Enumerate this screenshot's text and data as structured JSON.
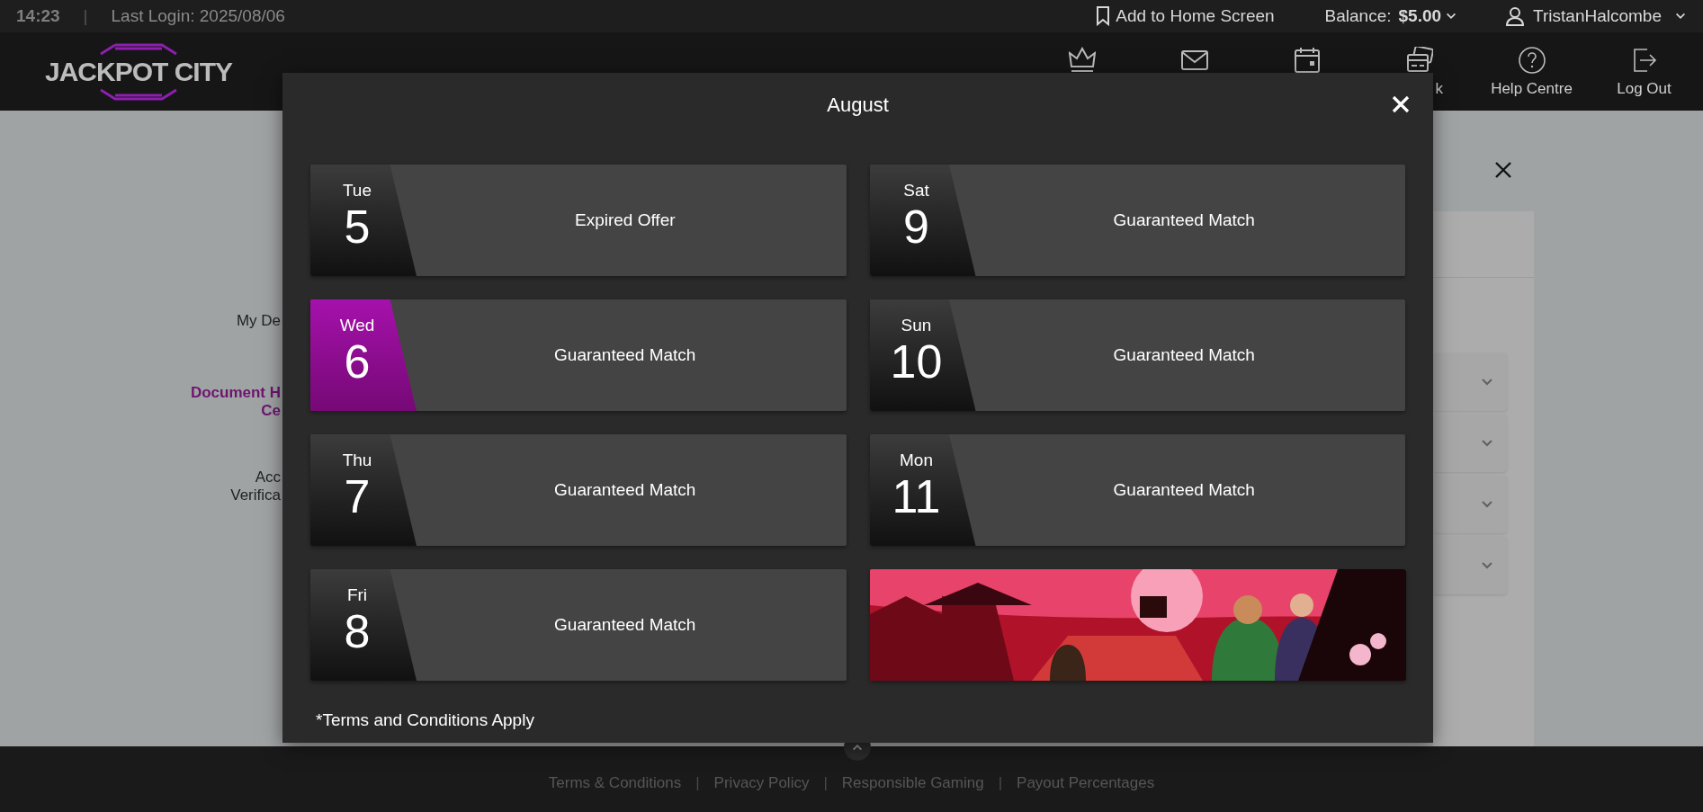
{
  "top_bar": {
    "time": "14:23",
    "separator": "|",
    "last_login": "Last Login: 2025/08/06",
    "add_to_home": "Add to Home Screen",
    "balance_label": "Balance:",
    "balance_value": "$5.00",
    "username": "TristanHalcombe"
  },
  "header": {
    "logo": "JACKPOT CITY",
    "nav": [
      {
        "kind": "item"
      },
      {
        "kind": "item"
      },
      {
        "kind": "item"
      },
      {
        "kind": "item",
        "label": "k",
        "clipped_left": true
      },
      {
        "kind": "item",
        "label": "Help Centre"
      },
      {
        "kind": "item",
        "label": "Log Out"
      }
    ]
  },
  "background_page": {
    "side_menu": [
      {
        "lines": [
          "My De"
        ],
        "selected": false
      },
      {
        "lines": [
          "Document H",
          "Ce"
        ],
        "selected": true
      },
      {
        "lines": [
          "Acc",
          "Verifica"
        ],
        "selected": false
      }
    ],
    "accordion_rows": [
      {
        "expanded": false
      },
      {
        "expanded": false
      },
      {
        "expanded": false
      },
      {
        "expanded": false
      }
    ]
  },
  "modal": {
    "title": "August",
    "items": [
      {
        "kind": "day",
        "weekday": "Tue",
        "day": "5",
        "offer": "Expired Offer",
        "selected": false
      },
      {
        "kind": "day",
        "weekday": "Wed",
        "day": "6",
        "offer": "Guaranteed Match",
        "selected": true
      },
      {
        "kind": "day",
        "weekday": "Thu",
        "day": "7",
        "offer": "Guaranteed Match",
        "selected": false
      },
      {
        "kind": "day",
        "weekday": "Fri",
        "day": "8",
        "offer": "Guaranteed Match",
        "selected": false
      },
      {
        "kind": "day",
        "weekday": "Sat",
        "day": "9",
        "offer": "Guaranteed Match",
        "selected": false
      },
      {
        "kind": "day",
        "weekday": "Sun",
        "day": "10",
        "offer": "Guaranteed Match",
        "selected": false
      },
      {
        "kind": "day",
        "weekday": "Mon",
        "day": "11",
        "offer": "Guaranteed Match",
        "selected": false
      },
      {
        "kind": "picture"
      }
    ],
    "terms": "*Terms and Conditions Apply"
  },
  "footer": {
    "separator": "|",
    "links": [
      "Terms & Conditions",
      "Privacy Policy",
      "Responsible Gaming",
      "Payout Percentages"
    ]
  }
}
